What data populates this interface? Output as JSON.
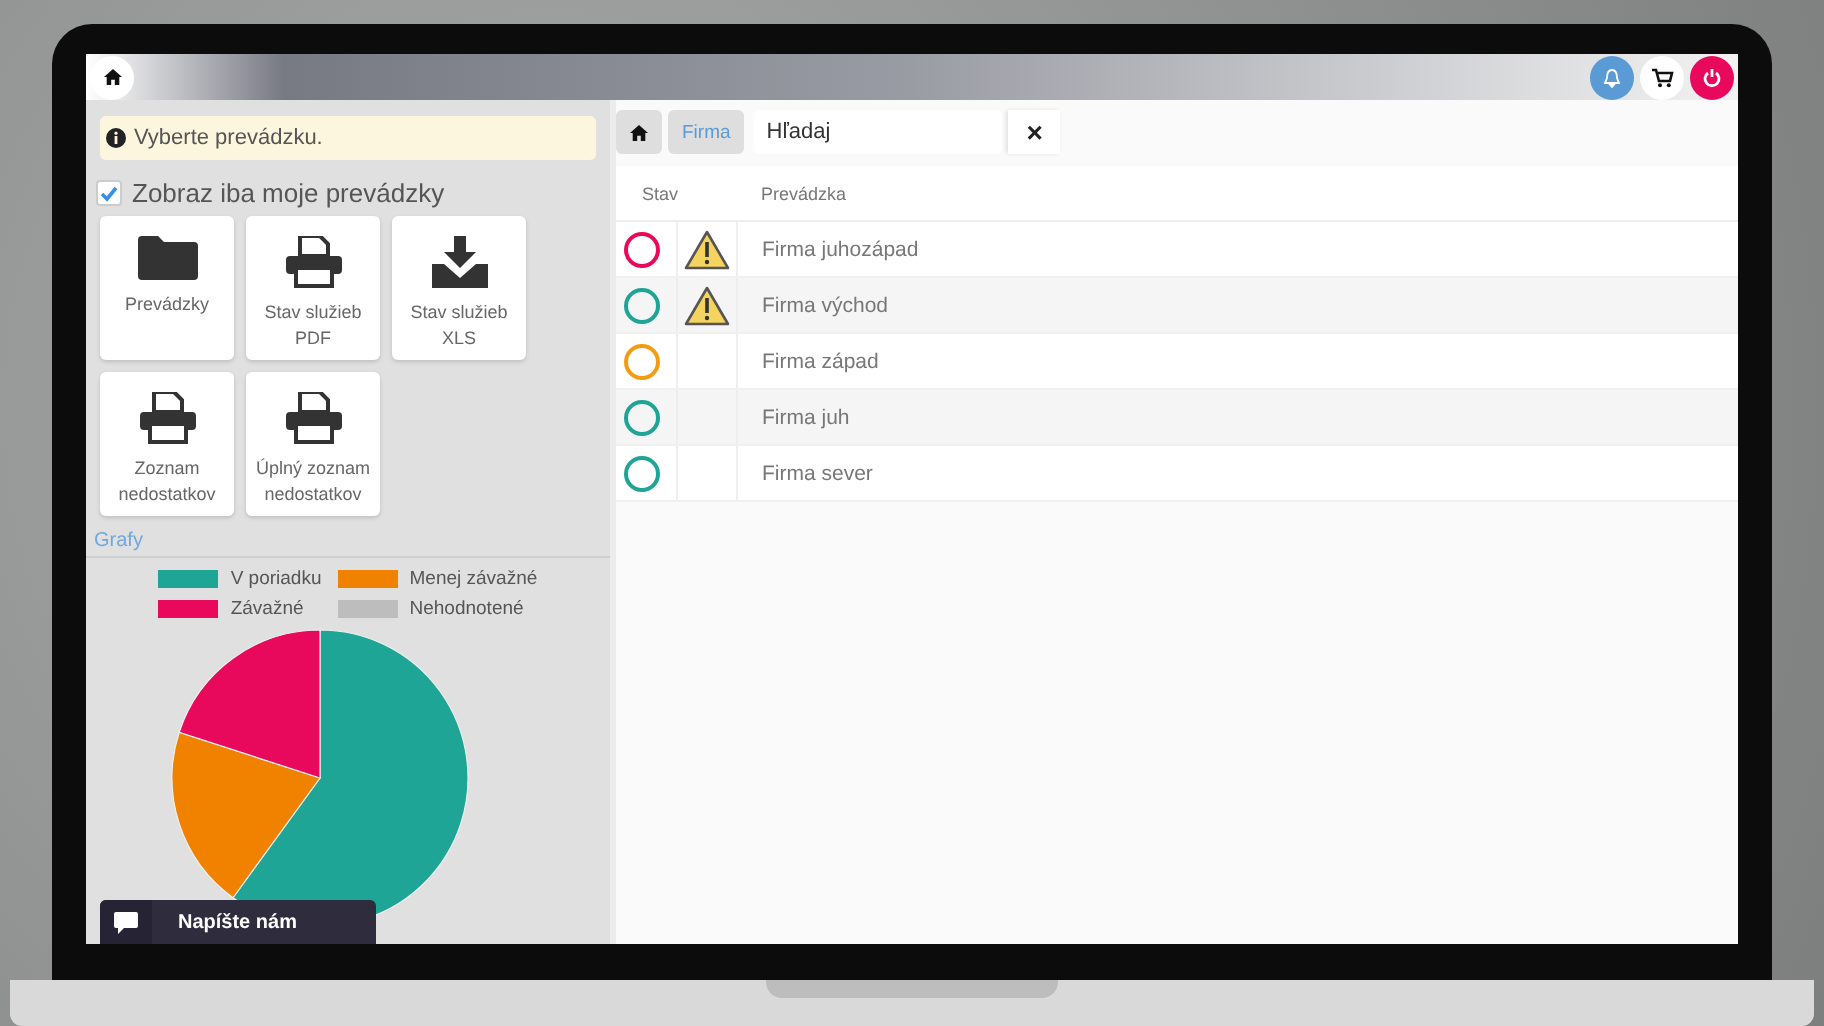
{
  "topbar": {
    "icons": [
      {
        "kind": "bell"
      },
      {
        "kind": "cart"
      },
      {
        "kind": "power"
      }
    ]
  },
  "notice": {
    "text": "Vyberte prevádzku."
  },
  "filter": {
    "label": "Zobraz iba moje prevádzky",
    "checked": true
  },
  "tiles": [
    {
      "kind": "folder",
      "label": "Prevádzky"
    },
    {
      "kind": "print",
      "label": "Stav služieb PDF"
    },
    {
      "kind": "download",
      "label": "Stav služieb XLS"
    },
    {
      "kind": "print",
      "label": "Zoznam nedostatkov"
    },
    {
      "kind": "print",
      "label": "Úplný zoznam nedostatkov"
    }
  ],
  "charts": {
    "title": "Grafy",
    "legend": [
      {
        "color": "#1fa595"
      },
      {
        "color": "#f08200"
      },
      {
        "color": "#e9095c"
      },
      {
        "color": "#bdbdbd"
      }
    ],
    "chart_data": {
      "type": "pie",
      "categories": [
        "V poriadku",
        "Menej závažné",
        "Závažné",
        "Nehodnotené"
      ],
      "values": [
        60,
        20,
        20,
        0
      ]
    }
  },
  "chat": {
    "label": "Napíšte nám"
  },
  "breadcrumb": [
    {
      "kind": "home"
    },
    {
      "kind": "text",
      "label": "Firma"
    }
  ],
  "search": {
    "value": "Hľadaj",
    "clear": "×"
  },
  "table": {
    "columns": [
      "Stav",
      "Prevádzka"
    ],
    "rows": [
      {
        "color": "#e9095c",
        "warning": true,
        "name": "Firma juhozápad"
      },
      {
        "color": "#1fa595",
        "warning": true,
        "name": "Firma východ"
      },
      {
        "color": "#f39c12",
        "warning": false,
        "name": "Firma západ"
      },
      {
        "color": "#1fa595",
        "warning": false,
        "name": "Firma juh"
      },
      {
        "color": "#1fa595",
        "warning": false,
        "name": "Firma sever"
      }
    ]
  }
}
